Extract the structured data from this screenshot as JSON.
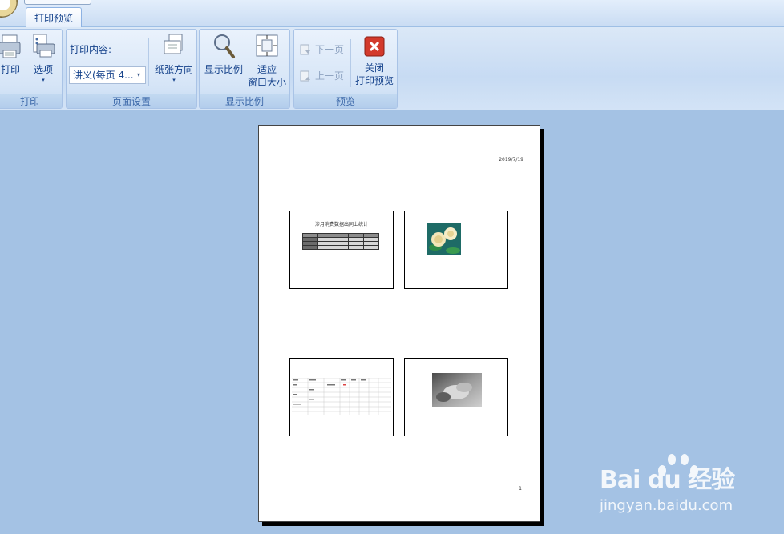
{
  "ribbon": {
    "tab_label": "打印预览",
    "groups": {
      "print": {
        "label": "打印",
        "print_btn": "打印",
        "options_btn": "选项"
      },
      "page_setup": {
        "label": "页面设置",
        "print_content_label": "打印内容:",
        "print_content_value": "讲义(每页 4...",
        "orientation_btn": "纸张方向"
      },
      "zoom": {
        "label": "显示比例",
        "zoom_btn": "显示比例",
        "fit_btn_line1": "适应",
        "fit_btn_line2": "窗口大小"
      },
      "preview": {
        "label": "预览",
        "next_page": "下一页",
        "prev_page": "上一页",
        "close_line1": "关闭",
        "close_line2": "打印预览"
      }
    }
  },
  "page": {
    "date": "2019/7/19",
    "page_number": "1",
    "slide1_title": "涉月消费数据出同上统计",
    "slide1_table": [
      [
        "",
        "",
        "",
        "",
        ""
      ],
      [
        "",
        "",
        "",
        "",
        ""
      ],
      [
        "",
        "",
        "",
        "",
        ""
      ],
      [
        "",
        "",
        "",
        "",
        ""
      ]
    ]
  },
  "watermark": {
    "brand": "Bai du 经验",
    "url": "jingyan.baidu.com"
  },
  "colors": {
    "workspace_bg": "#a4c2e4",
    "ribbon_text": "#15428b",
    "close_red": "#d33a2c"
  }
}
